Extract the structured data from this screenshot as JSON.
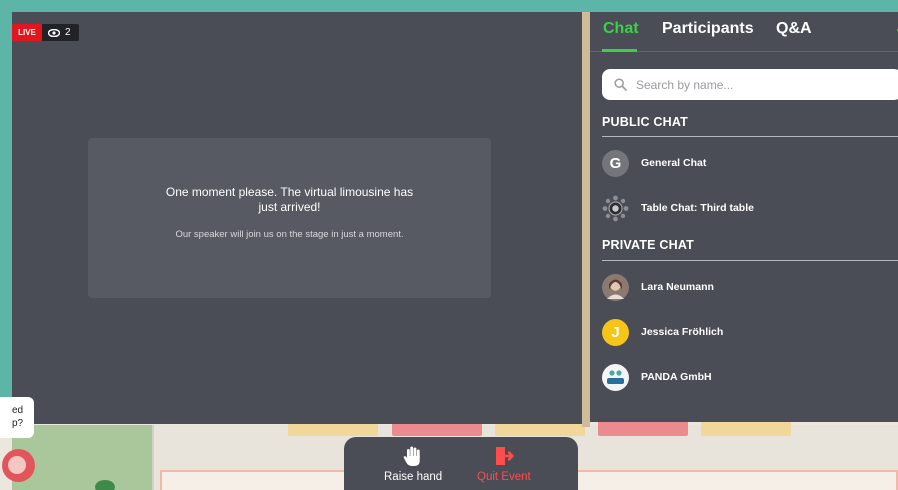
{
  "stage": {
    "live_label": "LIVE",
    "viewer_count": "2",
    "message": {
      "title": "One moment please. The virtual limousine has just arrived!",
      "subtitle": "Our speaker will join us on the stage in just a moment."
    }
  },
  "panel": {
    "tabs": [
      {
        "label": "Chat",
        "active": true
      },
      {
        "label": "Participants",
        "active": false
      },
      {
        "label": "Q&A",
        "active": false
      }
    ],
    "search_placeholder": "Search by name...",
    "public_chat": {
      "heading": "PUBLIC CHAT",
      "items": [
        {
          "name": "General Chat",
          "avatar_letter": "G",
          "avatar_color": "#75767c"
        },
        {
          "name": "Table Chat: Third table",
          "avatar_icon": "round-table-icon"
        }
      ]
    },
    "private_chat": {
      "heading": "PRIVATE CHAT",
      "items": [
        {
          "name": "Lara Neumann",
          "avatar_icon": "person-photo-avatar"
        },
        {
          "name": "Jessica Fröhlich",
          "avatar_letter": "J",
          "avatar_color": "#f5c518"
        },
        {
          "name": "PANDA GmbH",
          "avatar_icon": "panda-logo-avatar",
          "avatar_logo_text": "panda"
        }
      ]
    }
  },
  "controls": {
    "raise_hand": "Raise hand",
    "quit_event": "Quit Event"
  },
  "help": {
    "bubble_text_line1": "ed",
    "bubble_text_line2": "p?"
  },
  "colors": {
    "accent_green": "#3ccf4a",
    "live_red": "#e1161e",
    "quit_red": "#ff4d4d",
    "stage_bg": "#4a4c56"
  }
}
